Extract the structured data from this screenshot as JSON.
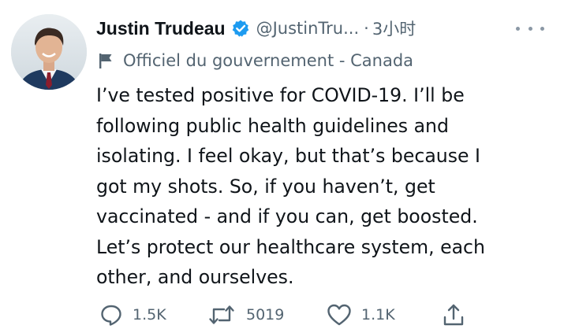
{
  "tweet": {
    "author_name": "Justin Trudeau",
    "handle": "@JustinTru...",
    "separator": "·",
    "time": "3小时",
    "account_label": "Officiel du gouvernement - Canada",
    "text": "I’ve tested positive for COVID-19. I’ll be\nfollowing public health guidelines and\nisolating. I feel okay, but that’s because I\ngot my shots. So, if you haven’t, get\nvaccinated - and if you can, get boosted.\nLet’s protect our healthcare system, each\nother, and ourselves.",
    "verified": true,
    "icons": {
      "verified": "verified-badge-icon",
      "label": "flag-icon",
      "more": "more-icon",
      "reply": "reply-icon",
      "retweet": "retweet-icon",
      "like": "like-icon",
      "share": "share-icon"
    }
  },
  "actions": {
    "replies": "1.5K",
    "retweets": "5019",
    "likes": "1.1K"
  },
  "colors": {
    "text_primary": "#0f1419",
    "text_secondary": "#536471",
    "verified_blue": "#1d9bf0",
    "background": "#ffffff"
  }
}
